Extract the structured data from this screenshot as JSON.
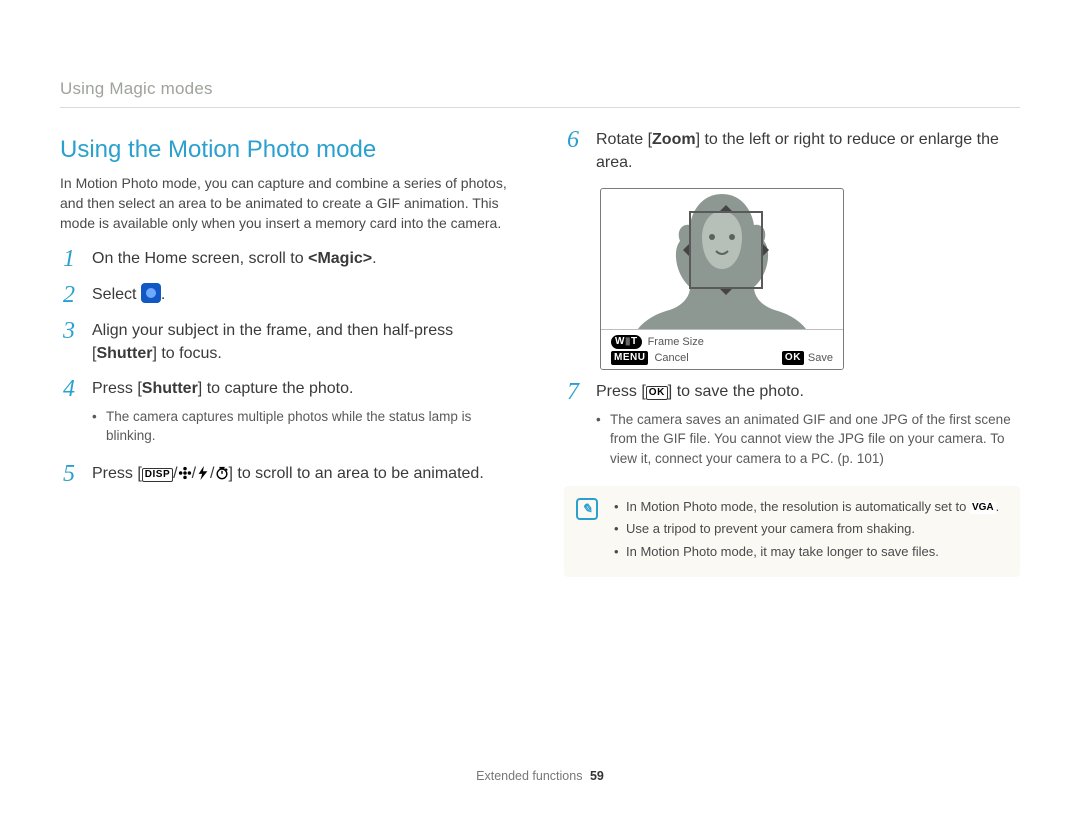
{
  "breadcrumb": "Using Magic modes",
  "title": "Using the Motion Photo mode",
  "intro": "In Motion Photo mode, you can capture and combine a series of photos, and then select an area to be animated to create a GIF animation. This mode is available only when you insert a memory card into the camera.",
  "steps_left": [
    {
      "n": "1",
      "parts": [
        {
          "t": "On the Home screen, scroll to "
        },
        {
          "t": "<Magic>",
          "bold": true
        },
        {
          "t": "."
        }
      ]
    },
    {
      "n": "2",
      "parts": [
        {
          "t": "Select "
        },
        {
          "icon": "mode-icon"
        },
        {
          "t": "."
        }
      ]
    },
    {
      "n": "3",
      "parts": [
        {
          "t": "Align your subject in the frame, and then half-press ["
        },
        {
          "t": "Shutter",
          "bold": true
        },
        {
          "t": "] to focus."
        }
      ]
    },
    {
      "n": "4",
      "parts": [
        {
          "t": "Press ["
        },
        {
          "t": "Shutter",
          "bold": true
        },
        {
          "t": "] to capture the photo."
        }
      ],
      "sub": [
        "The camera captures multiple photos while the status lamp is blinking."
      ]
    },
    {
      "n": "5",
      "parts": [
        {
          "t": "Press ["
        },
        {
          "glyph": "DISP"
        },
        {
          "t": "/"
        },
        {
          "svg": "flower"
        },
        {
          "t": "/"
        },
        {
          "svg": "bolt"
        },
        {
          "t": "/"
        },
        {
          "svg": "timer"
        },
        {
          "t": "] to scroll to an area to be animated."
        }
      ]
    }
  ],
  "steps_right": [
    {
      "n": "6",
      "parts": [
        {
          "t": "Rotate ["
        },
        {
          "t": "Zoom",
          "bold": true
        },
        {
          "t": "] to the left or right to reduce or enlarge the area."
        }
      ]
    },
    {
      "n": "7",
      "parts": [
        {
          "t": "Press ["
        },
        {
          "glyph": "OK",
          "cls": "ok"
        },
        {
          "t": "] to save the photo."
        }
      ],
      "sub": [
        "The camera saves an animated GIF and one JPG of the first scene from the GIF file. You cannot view the JPG file on your camera. To view it, connect your camera to a PC. (p. 101)"
      ]
    }
  ],
  "screen_labels": {
    "wt": "W",
    "t": "T",
    "frame_size": "Frame Size",
    "menu": "MENU",
    "cancel": "Cancel",
    "ok": "OK",
    "save": "Save"
  },
  "notes": [
    {
      "parts": [
        {
          "t": "In Motion Photo mode, the resolution is automatically set to "
        },
        {
          "glyph": "VGA",
          "cls": "vga"
        },
        {
          "t": "."
        }
      ]
    },
    {
      "parts": [
        {
          "t": "Use a tripod to prevent your camera from shaking."
        }
      ]
    },
    {
      "parts": [
        {
          "t": "In Motion Photo mode, it may take longer to save files."
        }
      ]
    }
  ],
  "footer": {
    "section": "Extended functions",
    "page": "59"
  }
}
